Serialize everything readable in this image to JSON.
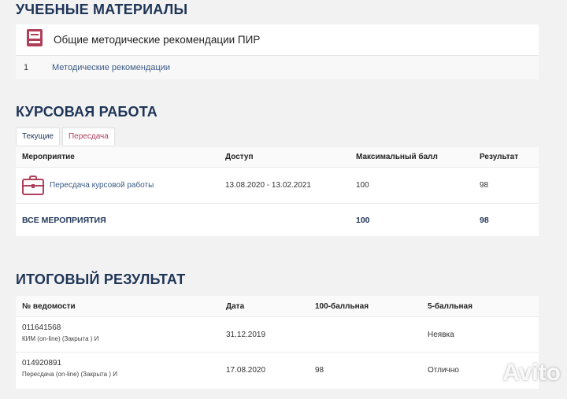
{
  "materials": {
    "title": "УЧЕБНЫЕ МАТЕРИАЛЫ",
    "card_title": "Общие методические рекомендации ПИР",
    "icon": "book-icon",
    "items": [
      {
        "num": "1",
        "label": "Методические рекомендации"
      }
    ]
  },
  "course": {
    "title": "КУРСОВАЯ РАБОТА",
    "tabs": [
      {
        "label": "Текущие",
        "active": true
      },
      {
        "label": "Пересдача",
        "active": false
      }
    ],
    "columns": [
      "Мероприятие",
      "Доступ",
      "Максимальный балл",
      "Результат"
    ],
    "rows": [
      {
        "icon": "briefcase-icon",
        "event": "Пересдача курсовой работы",
        "access": "13.08.2020 - 13.02.2021",
        "max": "100",
        "result": "98"
      }
    ],
    "total": {
      "label": "ВСЕ МЕРОПРИЯТИЯ",
      "max": "100",
      "result": "98"
    }
  },
  "final": {
    "title": "ИТОГОВЫЙ РЕЗУЛЬТАТ",
    "columns": [
      "№ ведомости",
      "Дата",
      "100-балльная",
      "5-балльная"
    ],
    "rows": [
      {
        "number": "011641568",
        "desc": "КИМ (on-line) (Закрыта ) И",
        "date": "31.12.2019",
        "score100": "",
        "score5": "Неявка"
      },
      {
        "number": "014920891",
        "desc": "Пересдача (on-line) (Закрыта ) И",
        "date": "17.08.2020",
        "score100": "98",
        "score5": "Отлично"
      }
    ]
  },
  "watermark": {
    "text": "Avito"
  },
  "colors": {
    "accent": "#1f3557",
    "link": "#3b5a86",
    "icon": "#b0405a",
    "background": "#f2f2f2"
  }
}
